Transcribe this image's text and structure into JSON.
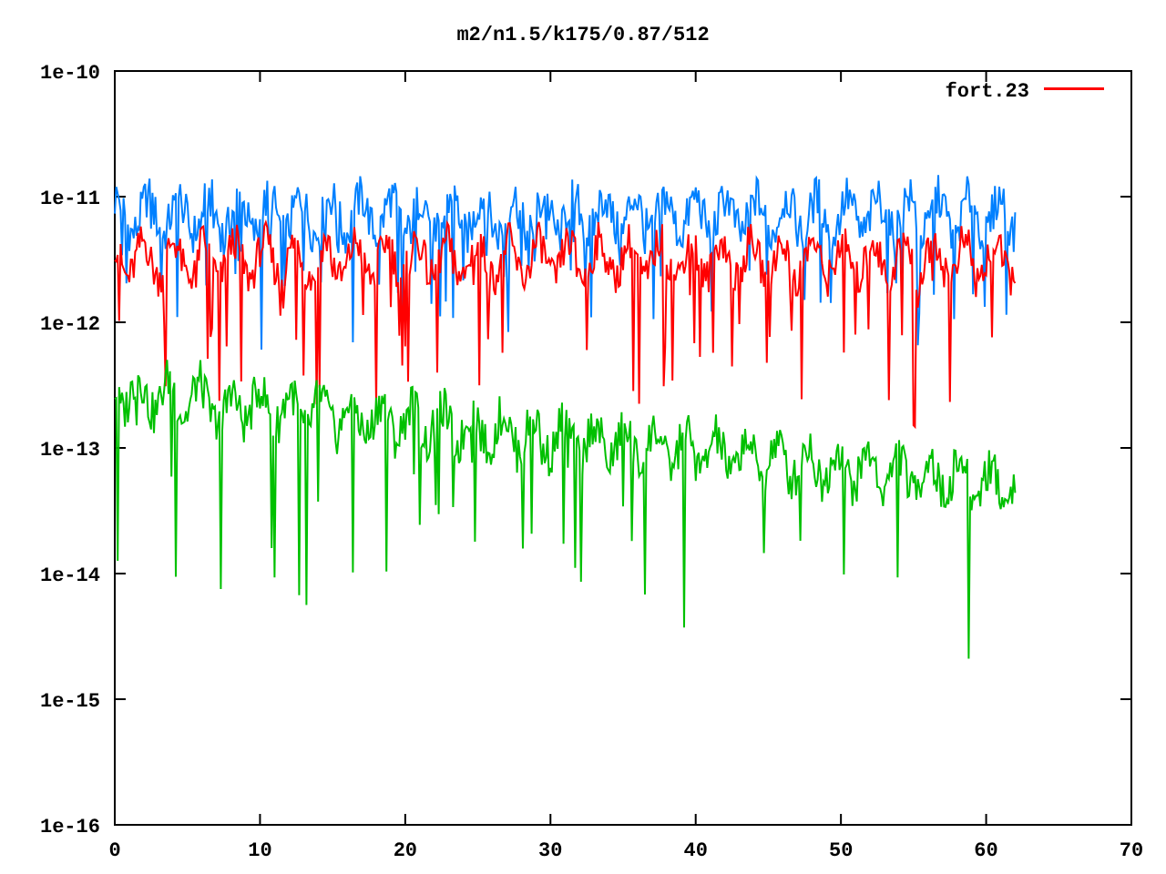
{
  "title": "m2/n1.5/k175/0.87/512",
  "legend": {
    "label": "fort.23",
    "color": "#ff0000"
  },
  "y_tick_labels": [
    "1e-10",
    "1e-11",
    "1e-12",
    "1e-13",
    "1e-14",
    "1e-15",
    "1e-16"
  ],
  "x_tick_labels": [
    "0",
    "10",
    "20",
    "30",
    "40",
    "50",
    "60",
    "70"
  ],
  "traces": [
    {
      "kind": "blue",
      "color": "#0080ff"
    },
    {
      "kind": "red",
      "color": "#ff0000"
    },
    {
      "kind": "green",
      "color": "#00c000"
    }
  ]
}
